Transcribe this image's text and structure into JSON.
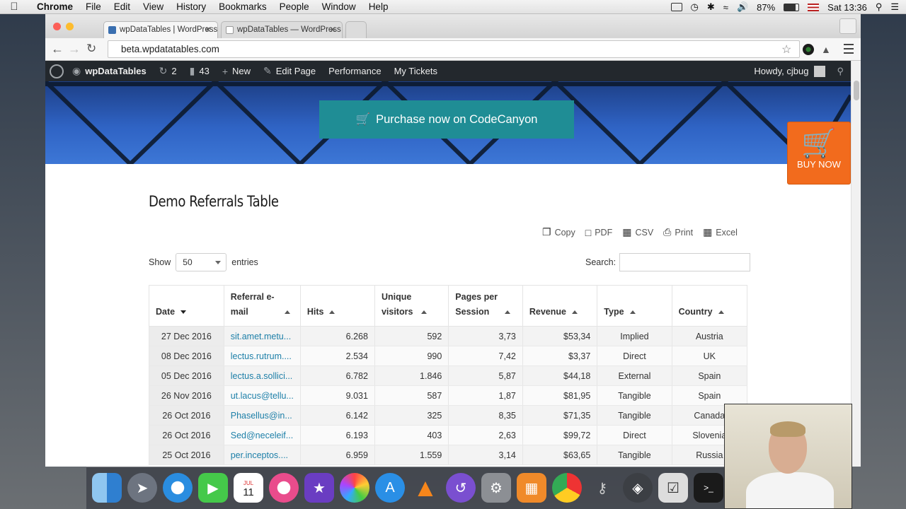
{
  "menubar": {
    "app": "Chrome",
    "items": [
      "File",
      "Edit",
      "View",
      "History",
      "Bookmarks",
      "People",
      "Window",
      "Help"
    ],
    "battery": "87%",
    "clock": "Sat 13:36"
  },
  "browser": {
    "tabs": [
      {
        "title": "wpDataTables | WordPress"
      },
      {
        "title": "wpDataTables — WordPress"
      }
    ],
    "url": "beta.wpdatatables.com"
  },
  "adminbar": {
    "site": "wpDataTables",
    "updates": "2",
    "comments": "43",
    "new": "New",
    "edit_page": "Edit Page",
    "performance": "Performance",
    "tickets": "My Tickets",
    "howdy": "Howdy, cjbug"
  },
  "hero": {
    "purchase_label": "Purchase now on CodeCanyon",
    "buy_now_label": "BUY NOW"
  },
  "table_title": "Demo Referrals Table",
  "tools": [
    {
      "label": "Copy",
      "icon": "copy-icon"
    },
    {
      "label": "PDF",
      "icon": "pdf-icon"
    },
    {
      "label": "CSV",
      "icon": "csv-icon"
    },
    {
      "label": "Print",
      "icon": "print-icon"
    },
    {
      "label": "Excel",
      "icon": "excel-icon"
    }
  ],
  "length": {
    "show": "Show",
    "value": "50",
    "entries": "entries"
  },
  "search": {
    "label": "Search:",
    "value": ""
  },
  "columns": [
    {
      "label": "Date",
      "sort": "down"
    },
    {
      "label": "Referral e-mail",
      "sort": "up"
    },
    {
      "label": "Hits",
      "sort": "up"
    },
    {
      "label": "Unique visitors",
      "sort": "up"
    },
    {
      "label": "Pages per Session",
      "sort": "up"
    },
    {
      "label": "Revenue",
      "sort": "up"
    },
    {
      "label": "Type",
      "sort": "up"
    },
    {
      "label": "Country",
      "sort": "up"
    }
  ],
  "rows": [
    [
      "27 Dec 2016",
      "sit.amet.metu...",
      "6.268",
      "592",
      "3,73",
      "$53,34",
      "Implied",
      "Austria"
    ],
    [
      "08 Dec 2016",
      "lectus.rutrum....",
      "2.534",
      "990",
      "7,42",
      "$3,37",
      "Direct",
      "UK"
    ],
    [
      "05 Dec 2016",
      "lectus.a.sollici...",
      "6.782",
      "1.846",
      "5,87",
      "$44,18",
      "External",
      "Spain"
    ],
    [
      "26 Nov 2016",
      "ut.lacus@tellu...",
      "9.031",
      "587",
      "1,87",
      "$81,95",
      "Tangible",
      "Spain"
    ],
    [
      "26 Oct 2016",
      "Phasellus@in...",
      "6.142",
      "325",
      "8,35",
      "$71,35",
      "Tangible",
      "Canada"
    ],
    [
      "26 Oct 2016",
      "Sed@neceleif...",
      "6.193",
      "403",
      "2,63",
      "$99,72",
      "Direct",
      "Slovenia"
    ],
    [
      "25 Oct 2016",
      "per.inceptos....",
      "6.959",
      "1.559",
      "3,14",
      "$63,65",
      "Tangible",
      "Russia"
    ]
  ],
  "dock": {
    "calendar_month": "JUL",
    "calendar_day": "11"
  }
}
